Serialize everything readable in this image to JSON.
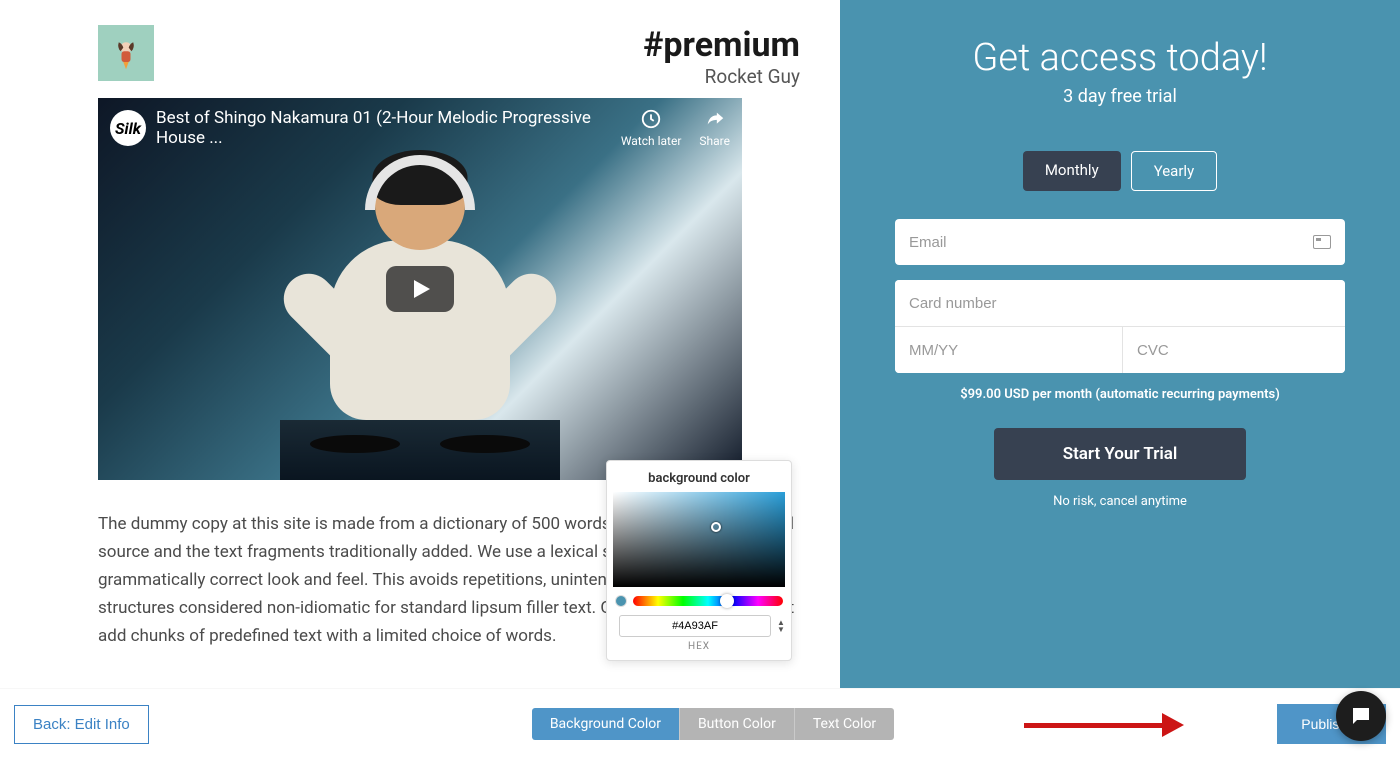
{
  "header": {
    "title": "#premium",
    "subtitle": "Rocket Guy"
  },
  "video": {
    "logo": "Silk",
    "title": "Best of Shingo Nakamura 01 (2-Hour Melodic Progressive House ...",
    "watch_later": "Watch later",
    "share": "Share"
  },
  "body_text": "The dummy copy at this site is made from a dictionary of 500 words from some text, original source and the text fragments traditionally added. We use a lexical scheme to ensure a grammatically correct look and feel. This avoids repetitions, unintentional humor, and structures considered non-idiomatic for standard lipsum filler text. Our generator doesn't just add chunks of predefined text with a limited choice of words.",
  "color_picker": {
    "label": "background color",
    "hex_value": "#4A93AF",
    "hex_label": "HEX"
  },
  "signup": {
    "title": "Get access today!",
    "subtitle": "3 day free trial",
    "monthly": "Monthly",
    "yearly": "Yearly",
    "email_placeholder": "Email",
    "card_placeholder": "Card number",
    "mmyy_placeholder": "MM/YY",
    "cvc_placeholder": "CVC",
    "price_note": "$99.00 USD per month (automatic recurring payments)",
    "start_label": "Start Your Trial",
    "risk_note": "No risk, cancel anytime"
  },
  "bottom": {
    "back": "Back: Edit Info",
    "seg_bg": "Background Color",
    "seg_btn": "Button Color",
    "seg_txt": "Text Color",
    "publish": "Publish it!"
  }
}
